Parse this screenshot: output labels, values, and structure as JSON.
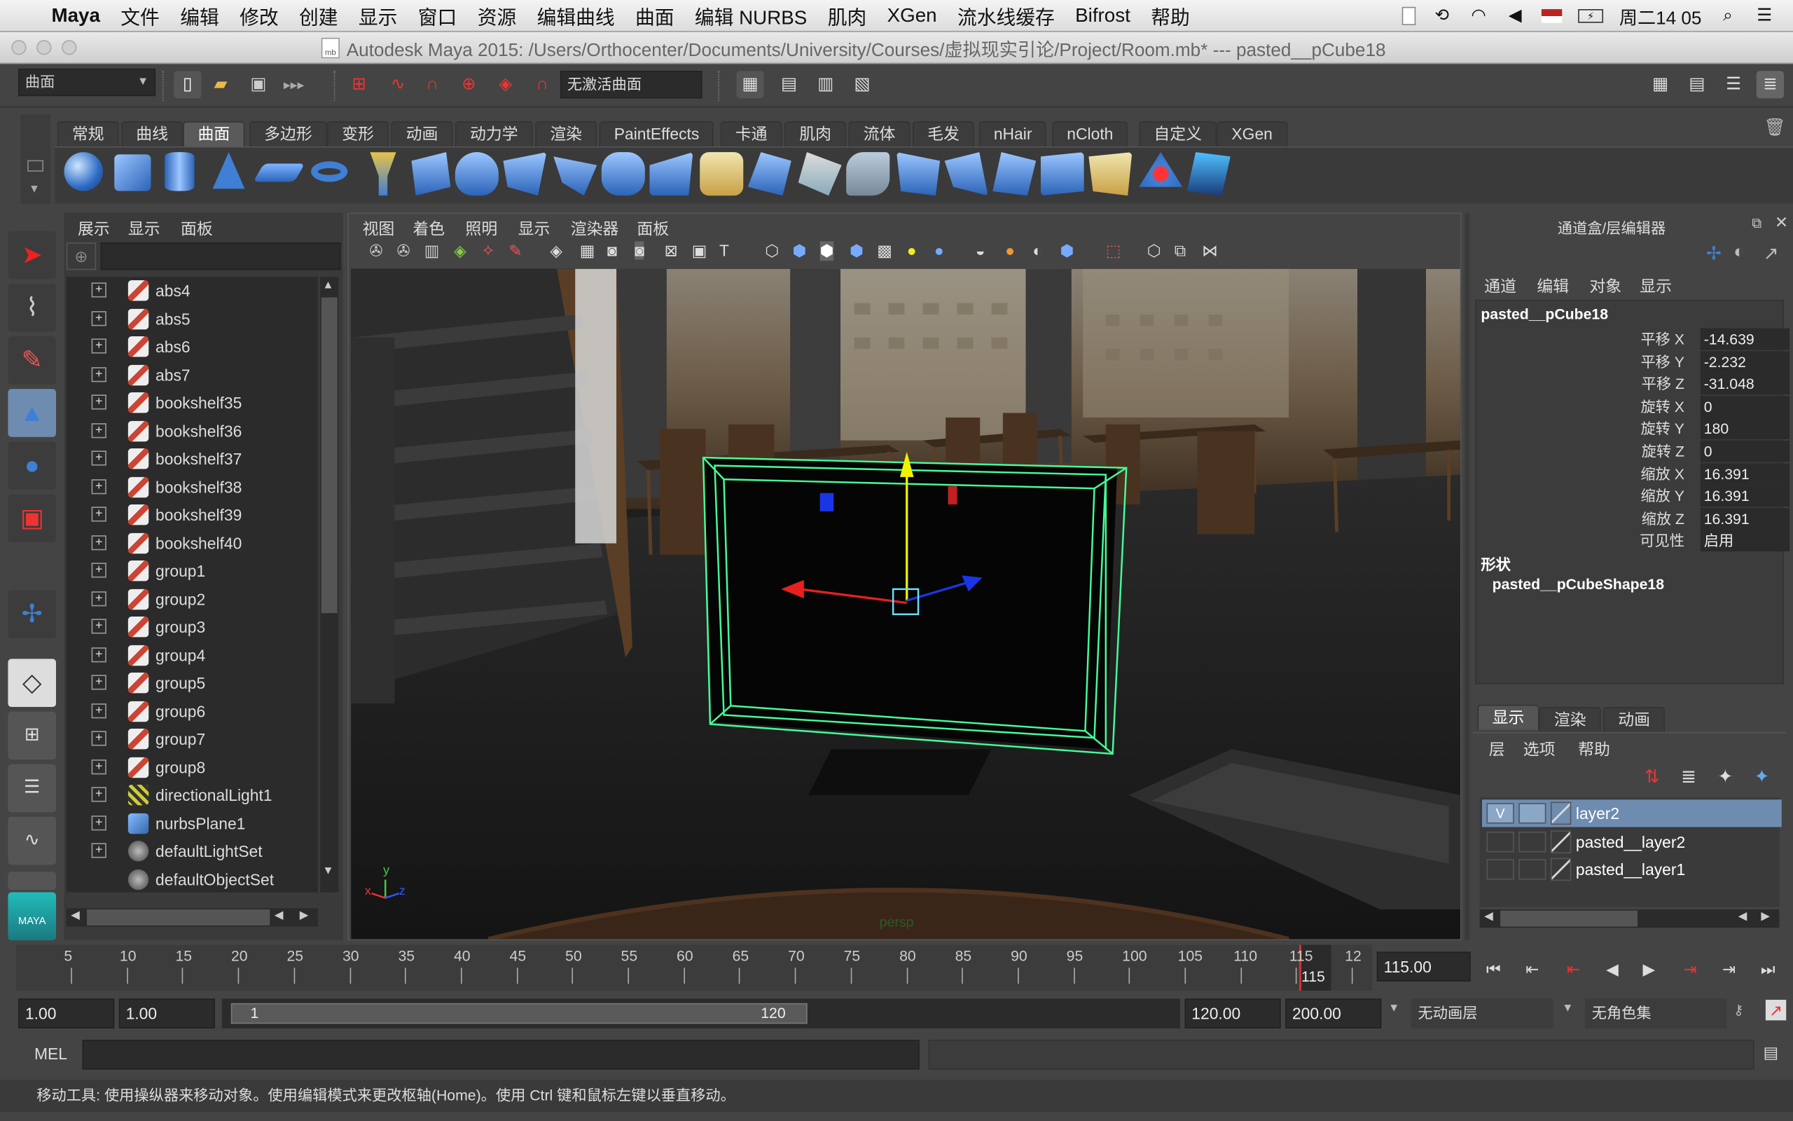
{
  "menubar": {
    "app": "Maya",
    "items": [
      "文件",
      "编辑",
      "修改",
      "创建",
      "显示",
      "窗口",
      "资源",
      "编辑曲线",
      "曲面",
      "编辑 NURBS",
      "肌肉",
      "XGen",
      "流水线缓存",
      "Bifrost",
      "帮助"
    ],
    "clock": "周二14 05"
  },
  "titlebar": {
    "title": "Autodesk Maya 2015: /Users/Orthocenter/Documents/University/Courses/虚拟现实引论/Project/Room.mb*   ---   pasted__pCube18"
  },
  "statusline": {
    "menuset": "曲面",
    "live_surface": "无激活曲面"
  },
  "shelf": {
    "tabs": [
      "常规",
      "曲线",
      "曲面",
      "多边形",
      "变形",
      "动画",
      "动力学",
      "渲染",
      "PaintEffects",
      "卡通",
      "肌肉",
      "流体",
      "毛发",
      "nHair",
      "nCloth",
      "自定义",
      "XGen"
    ],
    "active_tab": "曲面"
  },
  "outliner": {
    "menu": [
      "展示",
      "显示",
      "面板"
    ],
    "items": [
      {
        "label": "abs4",
        "type": "mesh",
        "expand": true
      },
      {
        "label": "abs5",
        "type": "mesh",
        "expand": true
      },
      {
        "label": "abs6",
        "type": "mesh",
        "expand": true
      },
      {
        "label": "abs7",
        "type": "mesh",
        "expand": true
      },
      {
        "label": "bookshelf35",
        "type": "mesh",
        "expand": true
      },
      {
        "label": "bookshelf36",
        "type": "mesh",
        "expand": true
      },
      {
        "label": "bookshelf37",
        "type": "mesh",
        "expand": true
      },
      {
        "label": "bookshelf38",
        "type": "mesh",
        "expand": true
      },
      {
        "label": "bookshelf39",
        "type": "mesh",
        "expand": true
      },
      {
        "label": "bookshelf40",
        "type": "mesh",
        "expand": true
      },
      {
        "label": "group1",
        "type": "mesh",
        "expand": true
      },
      {
        "label": "group2",
        "type": "mesh",
        "expand": true
      },
      {
        "label": "group3",
        "type": "mesh",
        "expand": true
      },
      {
        "label": "group4",
        "type": "mesh",
        "expand": true
      },
      {
        "label": "group5",
        "type": "mesh",
        "expand": true
      },
      {
        "label": "group6",
        "type": "mesh",
        "expand": true
      },
      {
        "label": "group7",
        "type": "mesh",
        "expand": true
      },
      {
        "label": "group8",
        "type": "mesh",
        "expand": true
      },
      {
        "label": "directionalLight1",
        "type": "light",
        "expand": true
      },
      {
        "label": "nurbsPlane1",
        "type": "nurbs",
        "expand": true
      },
      {
        "label": "defaultLightSet",
        "type": "set",
        "expand": true
      },
      {
        "label": "defaultObjectSet",
        "type": "set",
        "expand": false
      }
    ]
  },
  "viewport": {
    "menu": [
      "视图",
      "着色",
      "照明",
      "显示",
      "渲染器",
      "面板"
    ],
    "camera_label": "persp",
    "axis_x": "x",
    "axis_y": "y",
    "axis_z": "z"
  },
  "channelbox": {
    "header": "通道盒/层编辑器",
    "menu": [
      "通道",
      "编辑",
      "对象",
      "显示"
    ],
    "object": "pasted__pCube18",
    "channels": [
      {
        "label": "平移 X",
        "value": "-14.639"
      },
      {
        "label": "平移 Y",
        "value": "-2.232"
      },
      {
        "label": "平移 Z",
        "value": "-31.048"
      },
      {
        "label": "旋转 X",
        "value": "0"
      },
      {
        "label": "旋转 Y",
        "value": "180"
      },
      {
        "label": "旋转 Z",
        "value": "0"
      },
      {
        "label": "缩放 X",
        "value": "16.391"
      },
      {
        "label": "缩放 Y",
        "value": "16.391"
      },
      {
        "label": "缩放 Z",
        "value": "16.391"
      },
      {
        "label": "可见性",
        "value": "启用"
      }
    ],
    "shapes_label": "形状",
    "shape": "pasted__pCubeShape18"
  },
  "layereditor": {
    "tabs": [
      "显示",
      "渲染",
      "动画"
    ],
    "active_tab": "显示",
    "menu": [
      "层",
      "选项",
      "帮助"
    ],
    "layers": [
      {
        "name": "layer2",
        "visible": "V",
        "selected": true
      },
      {
        "name": "pasted__layer2",
        "visible": "",
        "selected": false
      },
      {
        "name": "pasted__layer1",
        "visible": "",
        "selected": false
      }
    ]
  },
  "timeslider": {
    "ticks": [
      "5",
      "10",
      "15",
      "20",
      "25",
      "30",
      "35",
      "40",
      "45",
      "50",
      "55",
      "60",
      "65",
      "70",
      "75",
      "80",
      "85",
      "90",
      "95",
      "100",
      "105",
      "110",
      "115",
      "12"
    ],
    "current_frame_label": "115",
    "current_frame": "115.00"
  },
  "rangeslider": {
    "anim_start": "1.00",
    "range_start": "1.00",
    "range_min_label": "1",
    "range_max_label": "120",
    "range_end": "120.00",
    "anim_end": "200.00",
    "anim_layer": "无动画层",
    "character_set": "无角色集"
  },
  "cmdline": {
    "lang": "MEL"
  },
  "helpline": {
    "text": "移动工具: 使用操纵器来移动对象。使用编辑模式来更改枢轴(Home)。使用 Ctrl 键和鼠标左键以垂直移动。"
  },
  "colors": {
    "selection": "#6e8cb0",
    "wire": "#44ff99",
    "manip_x": "#e8201f",
    "manip_y": "#f2f200",
    "manip_z": "#1a35e8"
  }
}
